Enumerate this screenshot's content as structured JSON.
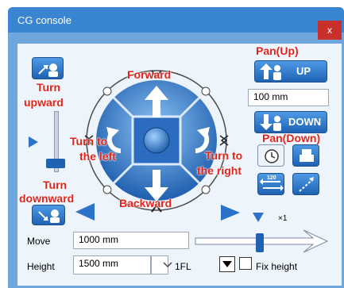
{
  "window": {
    "title": "CG console",
    "close_label": "x"
  },
  "annotations": {
    "pan_up": "Pan(Up)",
    "pan_down": "Pan(Down)",
    "forward": "Forward",
    "backward": "Backward",
    "turn_upward_1": "Turn",
    "turn_upward_2": "upward",
    "turn_downward_1": "Turn",
    "turn_downward_2": "downward",
    "turn_left_1": "Turn to",
    "turn_left_2": "the left",
    "turn_right_1": "Turn to",
    "turn_right_2": "the right"
  },
  "buttons": {
    "up_label": "UP",
    "down_label": "DOWN",
    "zoom_label": "120"
  },
  "fields": {
    "pan_value": "100 mm",
    "move_label": "Move",
    "move_value": "1000 mm",
    "height_label": "Height",
    "height_value": "1500 mm",
    "floor_value": "1FL",
    "fix_height_label": "Fix height",
    "speed_label": "×1"
  },
  "colors": {
    "accent": "#3a85d1",
    "annotation": "#e0241c",
    "button": "#2a73c8"
  },
  "icons": [
    "tilt-up-icon",
    "tilt-down-icon",
    "pan-up-icon",
    "pan-down-icon",
    "rotate-left-icon",
    "rotate-right-icon",
    "forward-arrow-icon",
    "backward-arrow-icon",
    "clock-icon",
    "printer-icon",
    "swap-icon",
    "path-icon"
  ]
}
